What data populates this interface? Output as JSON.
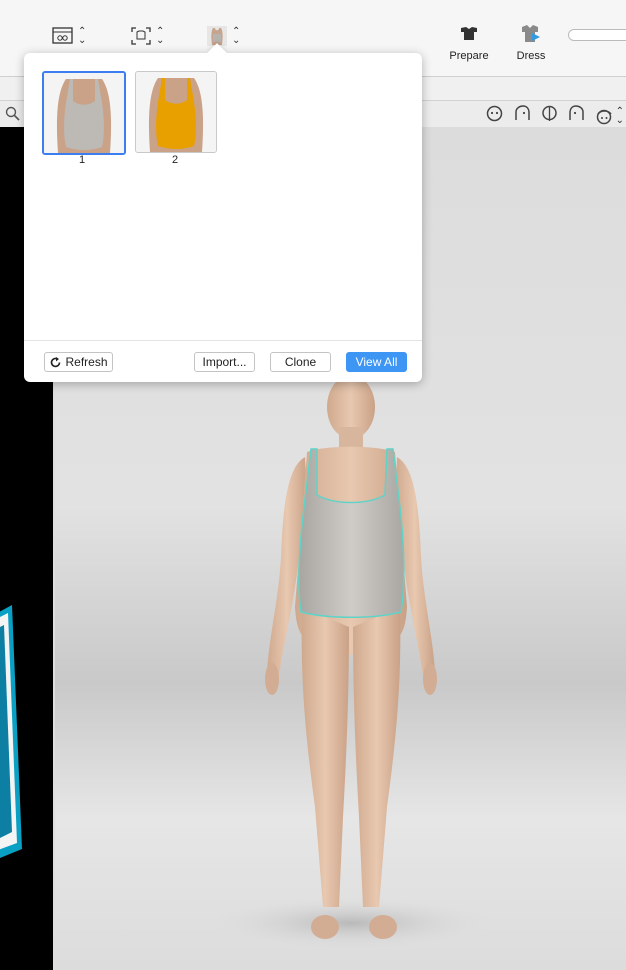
{
  "toolbar": {
    "tools": [
      {
        "name": "size-tool",
        "icon": "size-icon"
      },
      {
        "name": "camera-tool",
        "icon": "camera-frame-icon"
      },
      {
        "name": "garment-tool",
        "icon": "garment-icon"
      }
    ],
    "prepare_label": "Prepare",
    "dress_label": "Dress"
  },
  "popover": {
    "items": [
      {
        "number": "1",
        "color": "#bdbab6",
        "selected": true
      },
      {
        "number": "2",
        "color": "#e8a000",
        "selected": false
      }
    ],
    "refresh_label": "Refresh",
    "import_label": "Import...",
    "clone_label": "Clone",
    "view_all_label": "View All"
  },
  "colors": {
    "accent": "#3d95f4",
    "selection": "#3c7df0",
    "panel_edge": "#1aa6c6"
  }
}
